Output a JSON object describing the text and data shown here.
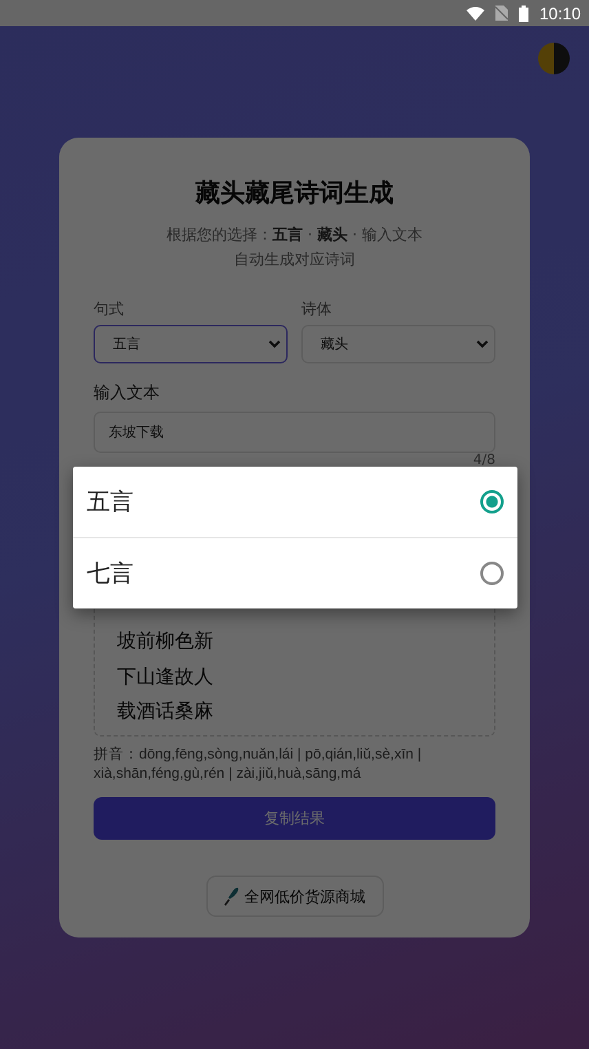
{
  "status_bar": {
    "time": "10:10"
  },
  "card": {
    "title": "藏头藏尾诗词生成",
    "subtitle": [
      "根据您的选择：**五言** · **藏头** · 输入文本",
      "自动生成对应诗词"
    ],
    "selects": [
      {
        "label": "句式",
        "value": "五言",
        "focused": true
      },
      {
        "label": "诗体",
        "value": "藏头",
        "focused": false
      }
    ],
    "text_input": {
      "label": "输入文本",
      "value": "东坡下载",
      "counter": "4/8"
    },
    "result": {
      "lines": [
        "坡前柳色新",
        "下山逢故人",
        "载酒话桑麻"
      ]
    },
    "pinyin": "拼音：dōng,fēng,sòng,nuǎn,lái | pō,qián,liǔ,sè,xīn | xià,shān,féng,gù,rén | zài,jiǔ,huà,sāng,má",
    "copy_button": "复制结果",
    "shop_button": "全网低价货源商城"
  },
  "dropdown": {
    "options": [
      {
        "label": "五言",
        "selected": true
      },
      {
        "label": "七言",
        "selected": false
      }
    ]
  }
}
